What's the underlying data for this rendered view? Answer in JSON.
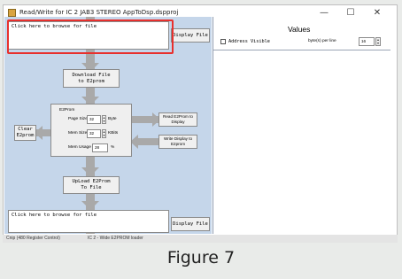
{
  "window": {
    "title": "Read/Write for IC 2 JAB3 STEREO AppToDsp.dspproj",
    "controls": {
      "minimize": "—",
      "maximize": "☐",
      "close": "✕"
    }
  },
  "left": {
    "top_input_placeholder": "Click here to browse for file",
    "top_display_button": "Display File",
    "download_button": "Download File to E2prom",
    "clear_button": "Clear E2prom",
    "eeprom_panel": {
      "title": "E2Prom",
      "page_size_label": "Page Size",
      "page_size_value": "32",
      "page_size_unit": "Byte",
      "mem_size_label": "Mem Size",
      "mem_size_value": "32",
      "mem_size_unit": "KBits",
      "mem_usage_label": "Mem Usage",
      "mem_usage_value": "28",
      "mem_usage_unit": "%"
    },
    "read_button": "Read E2Prom to Display",
    "write_button": "Write Display to E2prom",
    "upload_button": "UpLoad E2Prom To File",
    "bottom_input_placeholder": "Click here to browse for file",
    "bottom_display_button": "Display File"
  },
  "right": {
    "title": "Values",
    "address_visible_label": "Address Visible",
    "bytes_per_line_label": "byte(s) per line",
    "bytes_per_line_value": "16"
  },
  "statusbar": {
    "left_text": "Cnip (480 Register Control)",
    "right_text": "IC 2 - Wide E2PROM loader"
  },
  "caption": "Figure 7",
  "colors": {
    "left_background": "#c5d6ea",
    "pipe": "#a9a9a9",
    "highlight": "#e8302d"
  }
}
